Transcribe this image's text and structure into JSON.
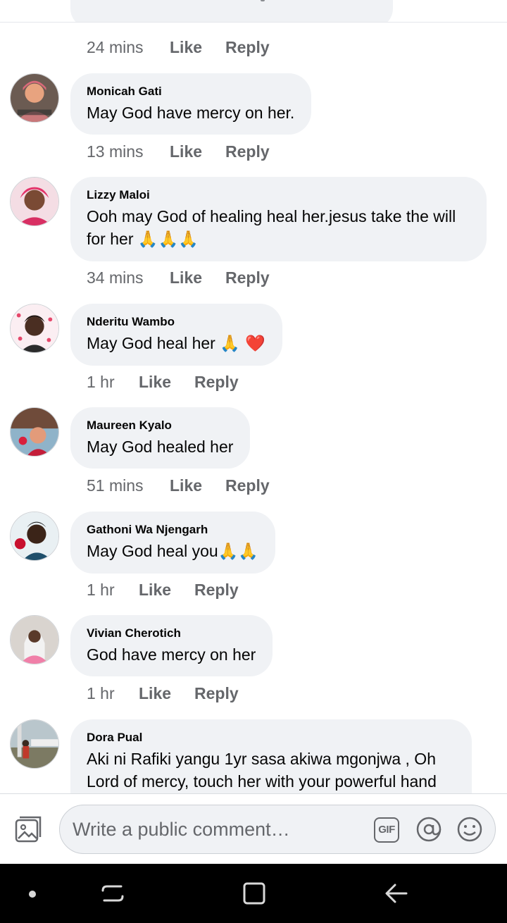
{
  "composer": {
    "placeholder": "Write a public comment…",
    "gif_label": "GIF"
  },
  "icons": {
    "photo": "photo-icon",
    "gif": "gif-icon",
    "mention": "at-icon",
    "emoji": "smiley-icon",
    "nav_dot": "dot-icon",
    "nav_recents": "recents-icon",
    "nav_home": "home-icon",
    "nav_back": "back-arrow-icon"
  },
  "colors": {
    "bubble": "#f0f2f5",
    "meta": "#65676b",
    "nav_bg": "#000000",
    "heart": "#e0245e"
  },
  "top_actions": {
    "time": "24 mins",
    "like": "Like",
    "reply": "Reply"
  },
  "comments": [
    {
      "name": "Monicah Gati",
      "text": "May God have mercy on her.",
      "emoji": "",
      "time": "13 mins",
      "like": "Like",
      "reply": "Reply"
    },
    {
      "name": "Lizzy Maloi",
      "text": "Ooh may God of healing heal her.jesus take the will for her",
      "emoji": "🙏🙏🙏",
      "time": "34 mins",
      "like": "Like",
      "reply": "Reply"
    },
    {
      "name": "Nderitu Wambo",
      "text": "May God heal her",
      "emoji": "🙏 ❤️",
      "time": "1 hr",
      "like": "Like",
      "reply": "Reply"
    },
    {
      "name": "Maureen Kyalo",
      "text": "May God healed her",
      "emoji": "",
      "time": "51 mins",
      "like": "Like",
      "reply": "Reply"
    },
    {
      "name": "Gathoni Wa Njengarh",
      "text": "May God heal you",
      "emoji": "🙏🙏",
      "time": "1 hr",
      "like": "Like",
      "reply": "Reply"
    },
    {
      "name": "Vivian Cherotich",
      "text": "God have mercy on her",
      "emoji": "",
      "time": "1 hr",
      "like": "Like",
      "reply": "Reply"
    },
    {
      "name": "Dora Pual",
      "text": "Aki ni Rafiki yangu  1yr sasa akiwa mgonjwa , Oh Lord of mercy, touch her with your powerful hand",
      "emoji": ""
    }
  ]
}
